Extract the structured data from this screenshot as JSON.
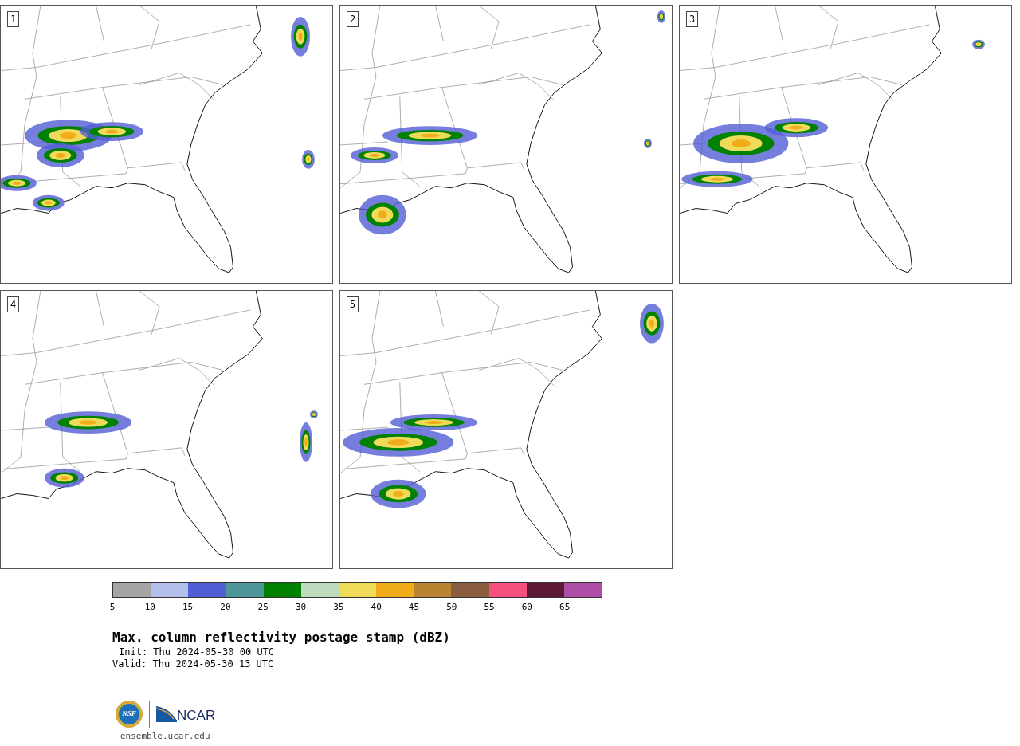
{
  "panels": [
    {
      "label": "1"
    },
    {
      "label": "2"
    },
    {
      "label": "3"
    },
    {
      "label": "4"
    },
    {
      "label": "5"
    }
  ],
  "colorbar": [
    {
      "color": "#a5a5a5",
      "tick": "5"
    },
    {
      "color": "#b5bfeb",
      "tick": "10"
    },
    {
      "color": "#525ed4",
      "tick": "15"
    },
    {
      "color": "#4f969b",
      "tick": "20"
    },
    {
      "color": "#008200",
      "tick": "25"
    },
    {
      "color": "#bddcbd",
      "tick": "30"
    },
    {
      "color": "#f0da5a",
      "tick": "35"
    },
    {
      "color": "#f0ad19",
      "tick": "40"
    },
    {
      "color": "#b98432",
      "tick": "45"
    },
    {
      "color": "#8a5c40",
      "tick": "50"
    },
    {
      "color": "#f4517e",
      "tick": "55"
    },
    {
      "color": "#5e1934",
      "tick": "60"
    },
    {
      "color": "#ad4da5",
      "tick": "65"
    }
  ],
  "title": "Max. column reflectivity postage stamp (dBZ)",
  "init": "Init: Thu 2024-05-30 00 UTC",
  "valid": "Valid: Thu 2024-05-30 13 UTC",
  "logo": {
    "seal": "NSF",
    "wordmark": "NCAR"
  },
  "site": "ensemble.ucar.edu"
}
